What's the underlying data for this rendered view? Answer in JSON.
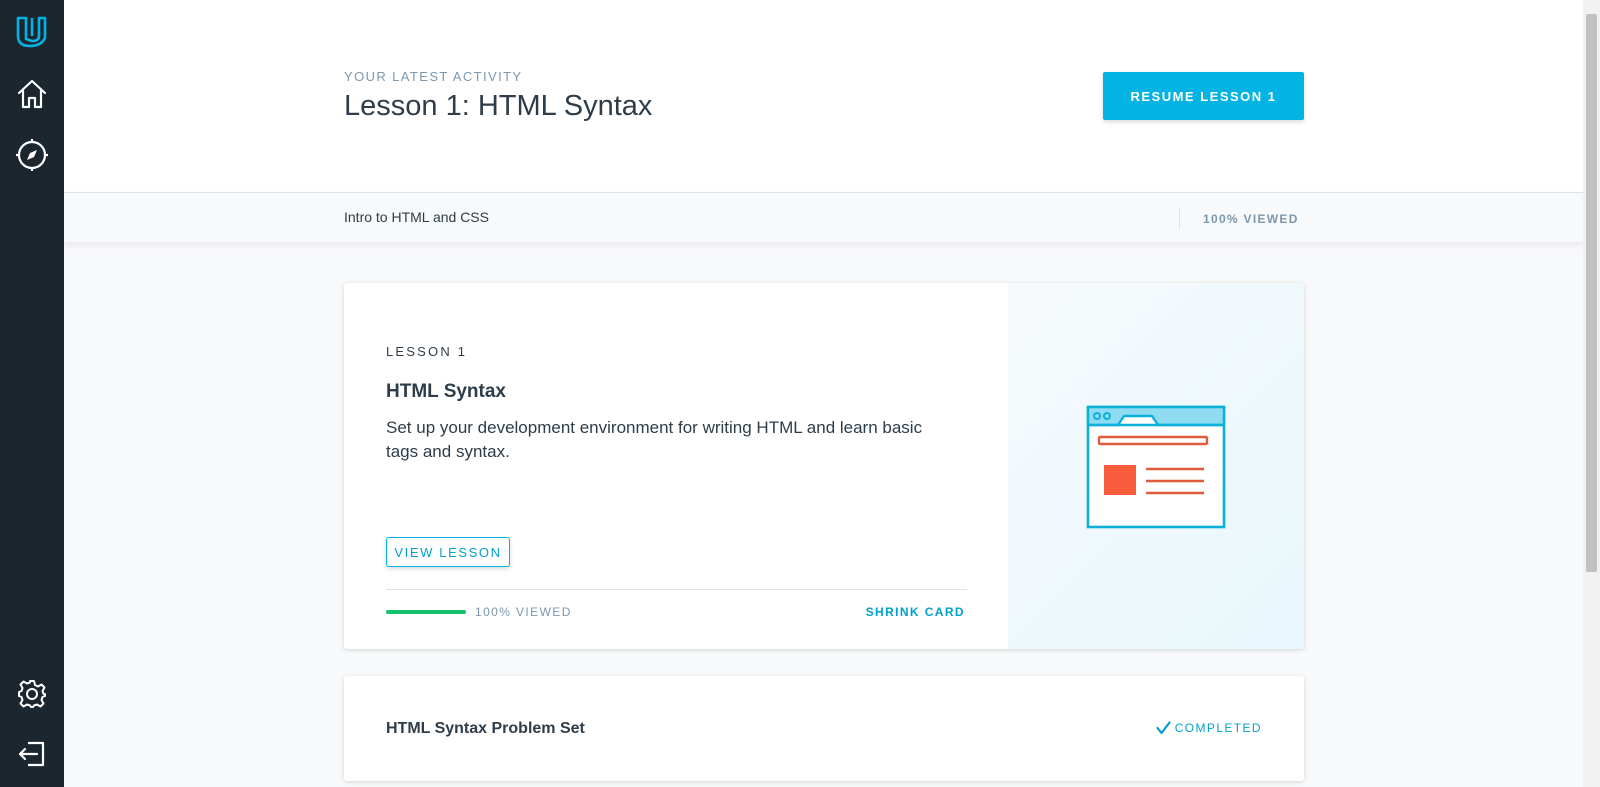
{
  "header": {
    "eyebrow": "YOUR LATEST ACTIVITY",
    "title": "Lesson 1: HTML Syntax",
    "resume_label": "RESUME LESSON 1"
  },
  "course_bar": {
    "course_name": "Intro to HTML and CSS",
    "viewed": "100% VIEWED"
  },
  "lesson_card": {
    "label": "LESSON 1",
    "title": "HTML Syntax",
    "description": "Set up your development environment for writing HTML and learn basic tags and syntax.",
    "view_label": "VIEW LESSON",
    "progress_fraction": 1.0,
    "viewed": "100% VIEWED",
    "shrink_label": "SHRINK CARD"
  },
  "problem_card": {
    "title": "HTML Syntax Problem Set",
    "status": "COMPLETED"
  },
  "sidebar": {
    "items": [
      "udacity-logo-icon",
      "home-icon",
      "compass-icon",
      "settings-icon",
      "logout-icon"
    ]
  },
  "colors": {
    "sidebar_bg": "#1c262f",
    "accent": "#02b3e4",
    "progress": "#15c26b",
    "illustration_orange": "#f95c3c"
  }
}
